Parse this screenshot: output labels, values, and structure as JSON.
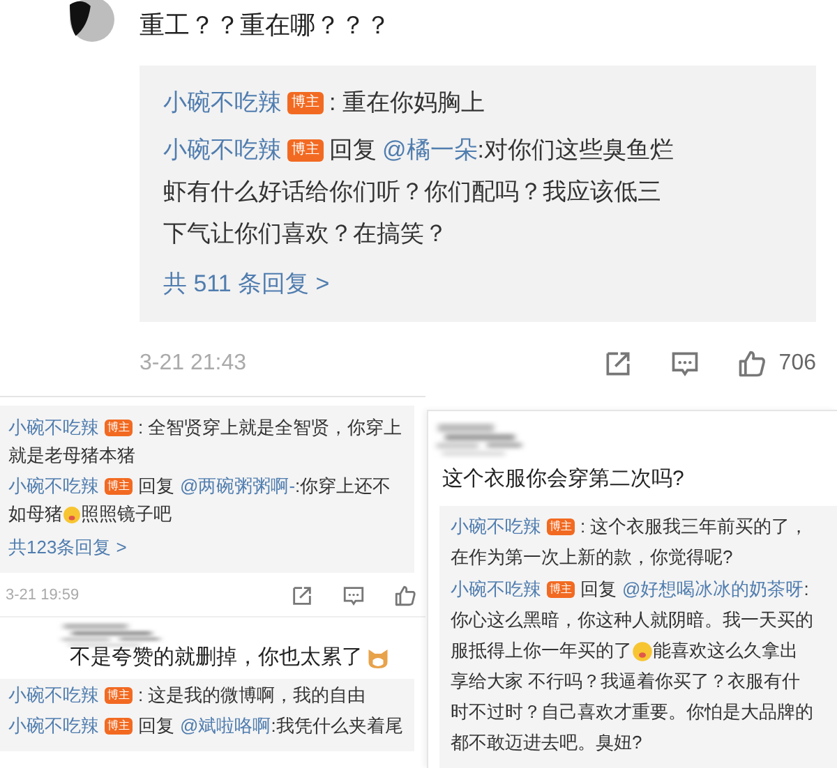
{
  "top_post": {
    "comment": "重工？？重在哪？？？",
    "replies": [
      {
        "name": "小碗不吃辣",
        "badge": "博主",
        "lines": [
          ": 重在你妈胸上"
        ]
      },
      {
        "name": "小碗不吃辣",
        "badge": "博主",
        "reply_label": "回复",
        "reply_to": "@橘一朵",
        "lines": [
          ":对你们这些臭鱼烂",
          "虾有什么好话给你们听？你们配吗？我应该低三",
          "下气让你们喜欢？在搞笑？"
        ]
      }
    ],
    "more": "共 511 条回复 >",
    "time": "3-21 21:43",
    "likes": "706"
  },
  "left_post": {
    "replies": [
      {
        "name": "小碗不吃辣",
        "badge": "博主",
        "lines": [
          ": 全智贤穿上就是全智贤，你穿上",
          "就是老母猪本猪"
        ]
      },
      {
        "name": "小碗不吃辣",
        "badge": "博主",
        "reply_label": "回复",
        "reply_to": "@两碗粥粥啊-",
        "lines": [
          ":你穿上还不",
          [
            "如母猪",
            "照照镜子吧"
          ]
        ]
      }
    ],
    "more": "共123条回复 >",
    "time": "3-21 19:59",
    "comment": "不是夸赞的就删掉，你也太累了",
    "trailing_emoji": true,
    "replies2": [
      {
        "name": "小碗不吃辣",
        "badge": "博主",
        "lines": [
          ": 这是我的微博啊，我的自由"
        ]
      },
      {
        "name": "小碗不吃辣",
        "badge": "博主",
        "reply_label": "回复",
        "reply_to": "@斌啦咯啊",
        "lines": [
          ":我凭什么夹着尾"
        ]
      }
    ]
  },
  "right_post": {
    "comment": "这个衣服你会穿第二次吗?",
    "replies": [
      {
        "name": "小碗不吃辣",
        "badge": "博主",
        "lines": [
          ": 这个衣服我三年前买的了，",
          "在作为第一次上新的款，你觉得呢?"
        ]
      },
      {
        "name": "小碗不吃辣",
        "badge": "博主",
        "reply_label": "回复",
        "reply_to": "@好想喝冰冰的奶茶呀",
        "lines": [
          ":",
          "你心这么黑暗，你这种人就阴暗。我一天买的",
          [
            "服抵得上你一年买的了",
            "能喜欢这么久拿出"
          ],
          "享给大家 不行吗？我逼着你买了？衣服有什",
          "时不过时？自己喜欢才重要。你怕是大品牌的",
          "都不敢迈进去吧。臭妞?"
        ]
      }
    ]
  }
}
